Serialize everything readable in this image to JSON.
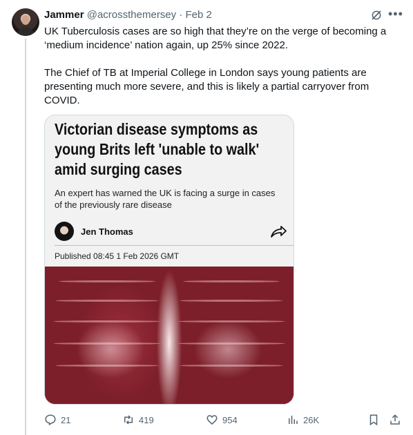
{
  "tweet": {
    "author_name": "Jammer",
    "handle": "@acrossthemersey",
    "separator": "·",
    "date": "Feb 2",
    "more_icon": "more-icon",
    "grok_icon": "grok-icon",
    "paragraphs": [
      "UK Tuberculosis cases are so high that they’re on the verge of becoming a ‘medium incidence’ nation again, up 25% since 2022.",
      "The Chief of TB at Imperial College in London says young patients are presenting much more severe, and this is likely a partial carryover from COVID."
    ]
  },
  "card": {
    "headline": "Victorian disease symptoms as young Brits left 'unable to walk' amid surging cases",
    "subheadline": "An expert has warned the UK is facing a surge in cases of the previously rare disease",
    "author": "Jen Thomas",
    "published": "Published 08:45 1 Feb 2026 GMT",
    "image_icon": "chest-xray-image"
  },
  "actions": {
    "replies": "21",
    "reposts": "419",
    "likes": "954",
    "views": "26K"
  },
  "colors": {
    "text": "#0f1419",
    "secondary": "#536471",
    "border": "#cfd9de"
  }
}
